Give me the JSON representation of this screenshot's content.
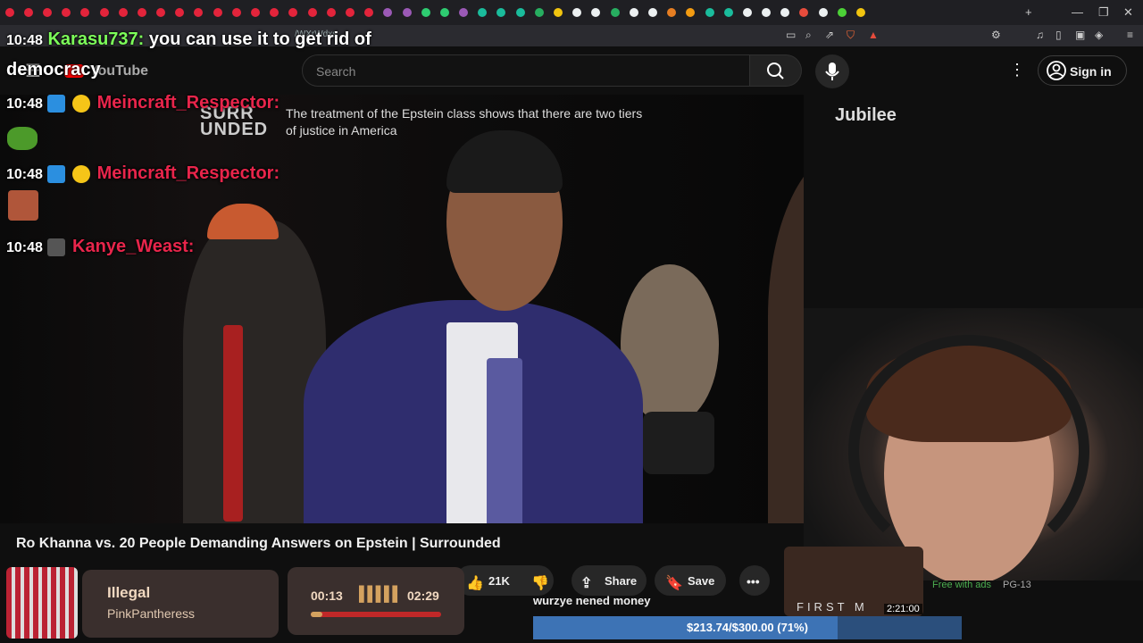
{
  "browser": {
    "tab_colors": [
      "#e3243b",
      "#e3243b",
      "#e3243b",
      "#e3243b",
      "#e3243b",
      "#e3243b",
      "#e3243b",
      "#e3243b",
      "#e3243b",
      "#e3243b",
      "#e3243b",
      "#e3243b",
      "#e3243b",
      "#e3243b",
      "#e3243b",
      "#e3243b",
      "#e3243b",
      "#e3243b",
      "#e3243b",
      "#e3243b",
      "#9b59b6",
      "#9b59b6",
      "#2ecc71",
      "#2ecc71",
      "#9b59b6",
      "#1abc9c",
      "#1abc9c",
      "#1abc9c",
      "#27ae60",
      "#f1c40f",
      "#ecf0f1",
      "#ecf0f1",
      "#27ae60",
      "#ecf0f1",
      "#ecf0f1",
      "#e67e22",
      "#f39c12",
      "#1abc9c",
      "#1abc9c",
      "#ecf0f1",
      "#ecf0f1",
      "#ecf0f1",
      "#e74c3c",
      "#ecf0f1",
      "#4cd137",
      "#f1c40f"
    ],
    "url": "/WXrWdxs"
  },
  "header": {
    "search_placeholder": "Search",
    "signin_label": "Sign in",
    "logo_text": "YouTube"
  },
  "video": {
    "overlay_brand": "SURR\nUNDED",
    "overlay_caption": "The treatment of the Epstein class shows that there are two tiers of justice in America",
    "watermark": "Jubilee",
    "title": "Ro Khanna vs. 20 People Demanding Answers on Epstein | Surrounded",
    "like_count": "21K",
    "share_label": "Share",
    "save_label": "Save"
  },
  "chat": [
    {
      "time": "10:48",
      "user": "Karasu737:",
      "message": "you can use it to get rid of democracy",
      "user_color": "#7dff5a"
    },
    {
      "time": "10:48",
      "user": "Meincraft_Respector:",
      "message": "",
      "user_color": "#e8254b"
    },
    {
      "time": "10:48",
      "user": "Meincraft_Respector:",
      "message": "",
      "user_color": "#e8254b"
    },
    {
      "time": "10:48",
      "user": "Kanye_Weast:",
      "message": "",
      "user_color": "#e8254b"
    }
  ],
  "music": {
    "song": "Illegal",
    "artist": "PinkPantheress"
  },
  "stream_timer": {
    "elapsed": "00:13",
    "total": "02:29",
    "progress": 0.09
  },
  "sidebar_suggestion": {
    "badge_free": "Free with ads",
    "rating": "PG-13",
    "duration": "2:21:00",
    "title_fragment": "FIRST M"
  },
  "donation_goal": {
    "label": "$213.74/$300.00 (71%)",
    "progress": 0.71
  },
  "tts_message": "wurzye nened money"
}
